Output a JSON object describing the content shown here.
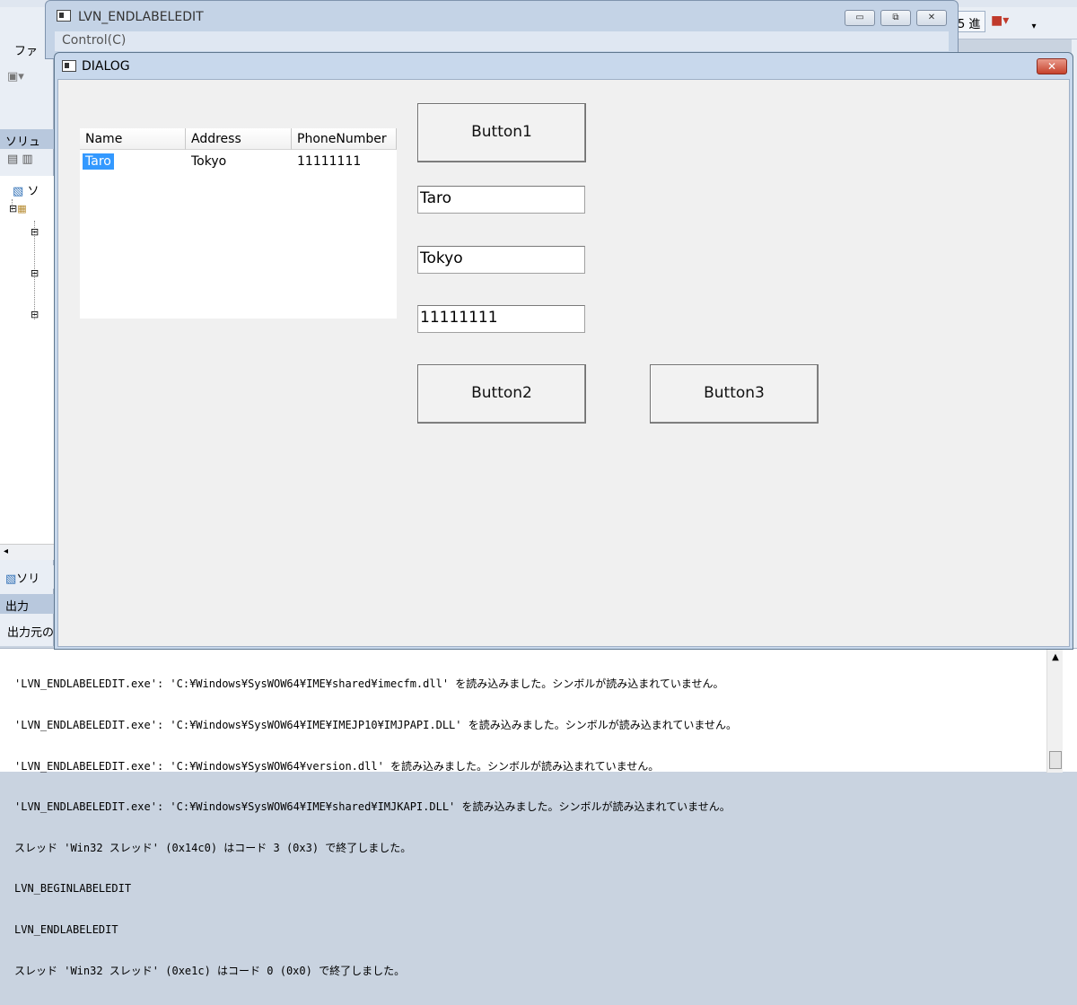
{
  "ide": {
    "hex_label": "5 進",
    "menu_file": "ファ",
    "solution_header": "ソリュ",
    "tree_root": "ソ",
    "solution_tab": "ソリ",
    "output_header": "出力",
    "output_source_label": "出力元の",
    "output_lines": [
      "'LVN_ENDLABELEDIT.exe': 'C:¥Windows¥SysWOW64¥IME¥shared¥imecfm.dll' を読み込みました。シンボルが読み込まれていません。",
      "'LVN_ENDLABELEDIT.exe': 'C:¥Windows¥SysWOW64¥IME¥IMEJP10¥IMJPAPI.DLL' を読み込みました。シンボルが読み込まれていません。",
      "'LVN_ENDLABELEDIT.exe': 'C:¥Windows¥SysWOW64¥version.dll' を読み込みました。シンボルが読み込まれていません。",
      "'LVN_ENDLABELEDIT.exe': 'C:¥Windows¥SysWOW64¥IME¥shared¥IMJKAPI.DLL' を読み込みました。シンボルが読み込まれていません。",
      "スレッド 'Win32 スレッド' (0x14c0) はコード 3 (0x3) で終了しました。",
      "LVN_BEGINLABELEDIT",
      "LVN_ENDLABELEDIT",
      "スレッド 'Win32 スレッド' (0xe1c) はコード 0 (0x0) で終了しました。"
    ]
  },
  "main_window": {
    "title": "LVN_ENDLABELEDIT",
    "menu": "Control(C)"
  },
  "dialog": {
    "title": "DIALOG",
    "listview": {
      "columns": [
        "Name",
        "Address",
        "PhoneNumber"
      ],
      "rows": [
        {
          "name": "Taro",
          "address": "Tokyo",
          "phone": "11111111",
          "selected": true
        }
      ]
    },
    "button1": "Button1",
    "button2": "Button2",
    "button3": "Button3",
    "edit_name": "Taro",
    "edit_address": "Tokyo",
    "edit_phone": "11111111"
  },
  "colors": {
    "selection": "#3399ff",
    "close_button": "#c6422c"
  }
}
